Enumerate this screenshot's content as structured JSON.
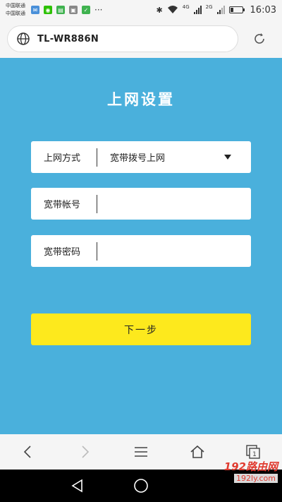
{
  "status_bar": {
    "carrier_1": "中国联通",
    "carrier_2": "中国联通",
    "network_1": "4G",
    "network_2": "2G",
    "time": "16:03",
    "icons": [
      "image-icon",
      "wechat-icon",
      "notes-icon",
      "photo-icon",
      "shield-icon",
      "more-dots-icon",
      "bluetooth-icon",
      "wifi-icon"
    ]
  },
  "browser": {
    "url": "TL-WR886N"
  },
  "page": {
    "title": "上网设置",
    "fields": [
      {
        "label": "上网方式",
        "value": "宽带拨号上网",
        "type": "select"
      },
      {
        "label": "宽带帐号",
        "value": "",
        "type": "text"
      },
      {
        "label": "宽带密码",
        "value": "",
        "type": "password"
      }
    ],
    "next_button": "下一步"
  },
  "watermark": {
    "logo": "192路由网",
    "url": "192ly.com"
  },
  "colors": {
    "background": "#4ab0dc",
    "button": "#fde91d",
    "chrome": "#f5f5f5"
  }
}
